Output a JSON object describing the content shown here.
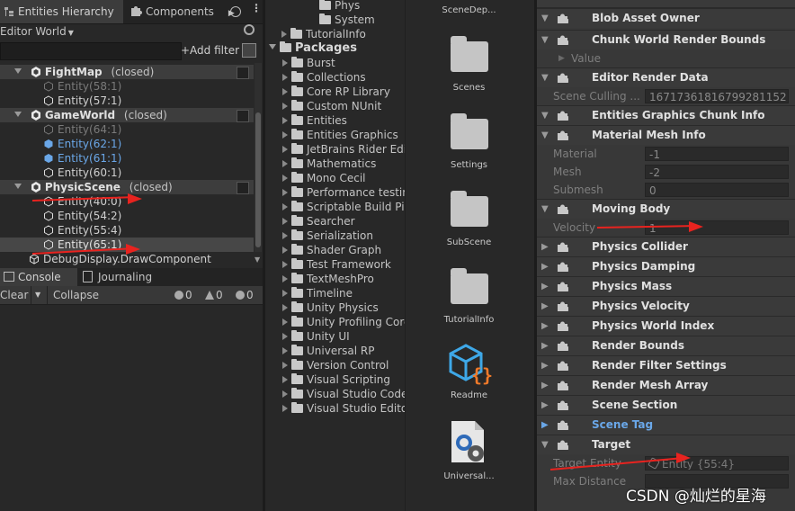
{
  "hierarchy": {
    "tab_label": "Entities Hierarchy",
    "world_select": "Editor World",
    "add_filter": "+Add filter",
    "groups": [
      {
        "name": "FightMap",
        "state": "(closed)",
        "entities": [
          "Entity(58:1)",
          "Entity(57:1)"
        ]
      },
      {
        "name": "GameWorld",
        "state": "(closed)",
        "entities": [
          "Entity(64:1)",
          "Entity(62:1)",
          "Entity(61:1)",
          "Entity(60:1)"
        ]
      },
      {
        "name": "PhysicScene",
        "state": "(closed)",
        "entities": [
          "Entity(40:0)",
          "Entity(54:2)",
          "Entity(55:4)",
          "Entity(65:1)"
        ]
      }
    ],
    "debug_item": "DebugDisplay.DrawComponent"
  },
  "components_tab": {
    "label": "Components"
  },
  "console": {
    "tab_console": "Console",
    "tab_journaling": "Journaling",
    "clear": "Clear",
    "collapse": "Collapse",
    "info_count": "0",
    "warn_count": "0",
    "error_count": "0"
  },
  "project": {
    "top_items": [
      "Phys",
      "System",
      "TutorialInfo"
    ],
    "packages_label": "Packages",
    "packages": [
      "Burst",
      "Collections",
      "Core RP Library",
      "Custom NUnit",
      "Entities",
      "Entities Graphics",
      "JetBrains Rider Edi",
      "Mathematics",
      "Mono Cecil",
      "Performance testin",
      "Scriptable Build Pip",
      "Searcher",
      "Serialization",
      "Shader Graph",
      "Test Framework",
      "TextMeshPro",
      "Timeline",
      "Unity Physics",
      "Unity Profiling Core",
      "Unity UI",
      "Universal RP",
      "Version Control",
      "Visual Scripting",
      "Visual Studio Code",
      "Visual Studio Editor"
    ]
  },
  "assets": [
    {
      "label": "SceneDep...",
      "kind": "partial"
    },
    {
      "label": "Scenes",
      "kind": "folder"
    },
    {
      "label": "Settings",
      "kind": "folder"
    },
    {
      "label": "SubScene",
      "kind": "folder"
    },
    {
      "label": "TutorialInfo",
      "kind": "folder"
    },
    {
      "label": "Readme",
      "kind": "readme-icon"
    },
    {
      "label": "Universal...",
      "kind": "settings-asset-icon"
    }
  ],
  "inspector": {
    "components": [
      {
        "name": "Blob Asset Owner",
        "expanded": true,
        "fields": []
      },
      {
        "name": "Chunk World Render Bounds",
        "expanded": true,
        "fields": [
          {
            "label": "Value",
            "value": ""
          }
        ]
      },
      {
        "name": "Editor Render Data",
        "expanded": true,
        "fields": [
          {
            "label": "Scene Culling ...",
            "value": "16717361816799281152"
          }
        ]
      },
      {
        "name": "Entities Graphics Chunk Info",
        "expanded": true,
        "fields": []
      },
      {
        "name": "Material Mesh Info",
        "expanded": true,
        "fields": [
          {
            "label": "Material",
            "value": "-1"
          },
          {
            "label": "Mesh",
            "value": "-2"
          },
          {
            "label": "Submesh",
            "value": "0"
          }
        ]
      },
      {
        "name": "Moving Body",
        "expanded": true,
        "fields": [
          {
            "label": "Velocity",
            "value": "1"
          }
        ]
      },
      {
        "name": "Physics Collider",
        "expanded": false,
        "fields": []
      },
      {
        "name": "Physics Damping",
        "expanded": false,
        "fields": []
      },
      {
        "name": "Physics Mass",
        "expanded": false,
        "fields": []
      },
      {
        "name": "Physics Velocity",
        "expanded": false,
        "fields": []
      },
      {
        "name": "Physics World Index",
        "expanded": false,
        "fields": []
      },
      {
        "name": "Render Bounds",
        "expanded": false,
        "fields": []
      },
      {
        "name": "Render Filter Settings",
        "expanded": false,
        "fields": []
      },
      {
        "name": "Render Mesh Array",
        "expanded": false,
        "fields": []
      },
      {
        "name": "Scene Section",
        "expanded": false,
        "fields": []
      },
      {
        "name": "Scene Tag",
        "expanded": false,
        "fields": []
      },
      {
        "name": "Target",
        "expanded": true,
        "fields": [
          {
            "label": "Target Entity",
            "value": "Entity {55:4}"
          },
          {
            "label": "Max Distance",
            "value": ""
          }
        ]
      }
    ],
    "watermark": "CSDN @灿烂的星海"
  },
  "colors": {
    "accent_blue": "#6aa7e8",
    "arrow_red": "#e8231f",
    "panel_bg": "#383838",
    "header_bg": "#3a3a3a"
  }
}
